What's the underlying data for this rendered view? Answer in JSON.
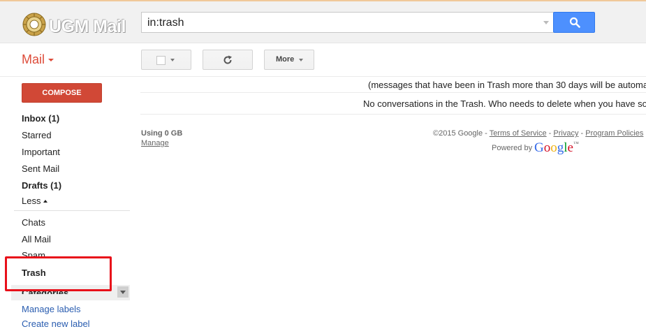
{
  "header": {
    "logo_text": "UGM Mail",
    "search": {
      "value": "in:trash"
    }
  },
  "toolbar": {
    "app_label": "Mail",
    "more_label": "More"
  },
  "sidebar": {
    "compose_label": "COMPOSE",
    "items": [
      {
        "label": "Inbox (1)",
        "bold": true
      },
      {
        "label": "Starred",
        "bold": false
      },
      {
        "label": "Important",
        "bold": false
      },
      {
        "label": "Sent Mail",
        "bold": false
      },
      {
        "label": "Drafts (1)",
        "bold": true
      },
      {
        "label": "Less",
        "bold": false
      },
      {
        "label": "Chats",
        "bold": false
      },
      {
        "label": "All Mail",
        "bold": false
      },
      {
        "label": "Spam",
        "bold": false
      },
      {
        "label": "Trash",
        "bold": true
      }
    ],
    "categories_label": "Categories",
    "manage_labels": "Manage labels",
    "create_label": "Create new label"
  },
  "main": {
    "trash_notice": "(messages that have been in Trash more than 30 days will be automa",
    "empty_message": "No conversations in the Trash. Who needs to delete when you have so",
    "storage_label": "Using 0 GB",
    "manage_link": "Manage"
  },
  "footer": {
    "copyright": "©2015 Google - ",
    "terms": "Terms of Service",
    "sep1": " - ",
    "privacy": "Privacy",
    "sep2": " - ",
    "policies": "Program Policies",
    "powered_by": "Powered by",
    "google": "Google",
    "tm": "™"
  },
  "colors": {
    "accent_red": "#dd4b39",
    "compose_red": "#d14836",
    "search_blue": "#4d90fe",
    "link_blue": "#2a5db0",
    "highlight_red": "#e8101a"
  }
}
